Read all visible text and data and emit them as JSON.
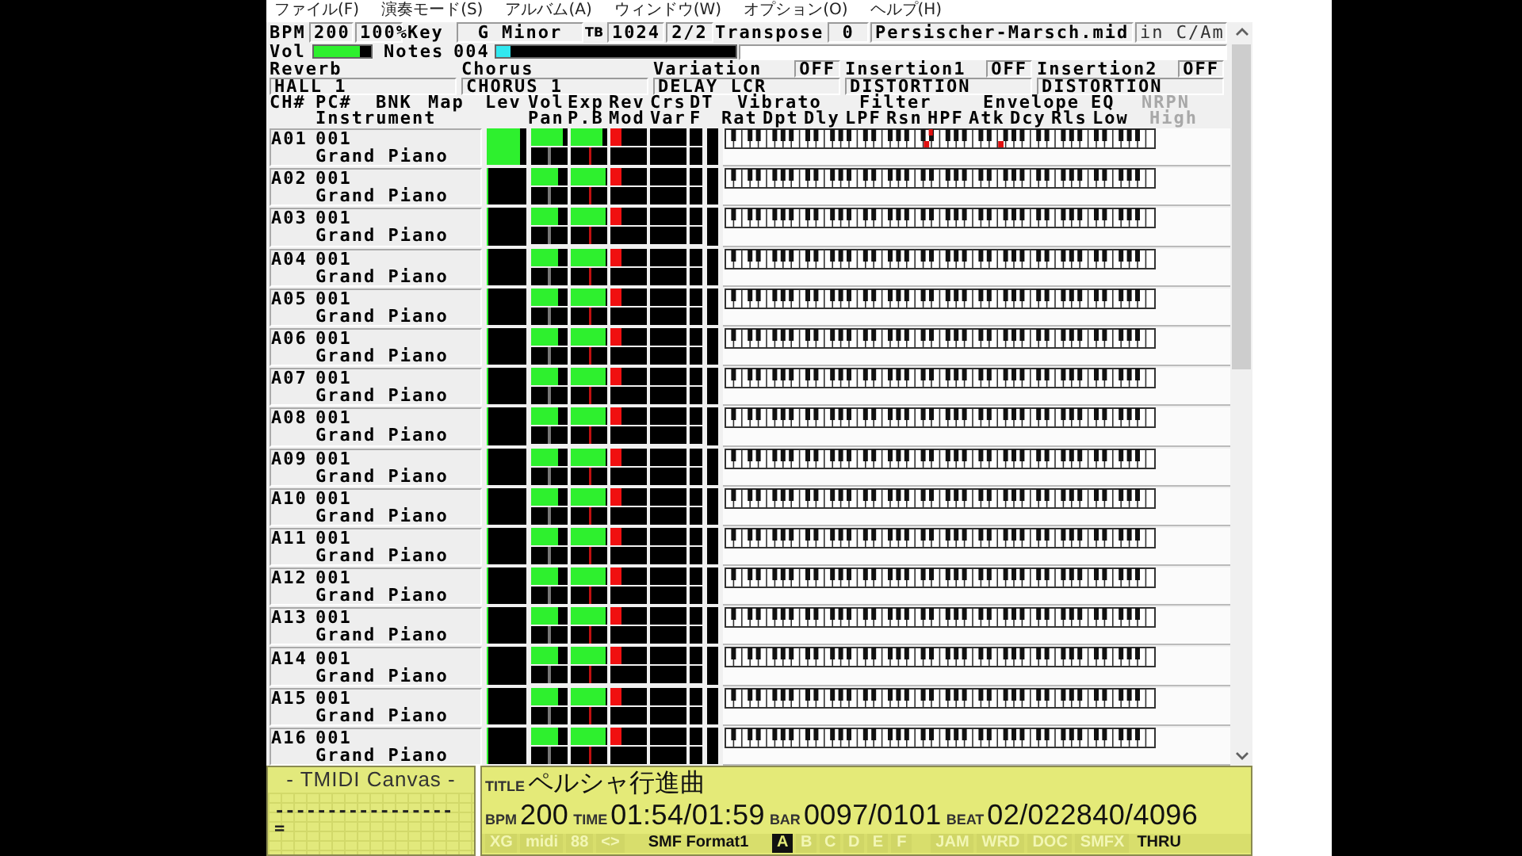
{
  "menu": [
    "ファイル(F)",
    "演奏モード(S)",
    "アルバム(A)",
    "ウィンドウ(W)",
    "オプション(O)",
    "ヘルプ(H)"
  ],
  "transport": {
    "bpm_label": "BPM",
    "bpm": "200",
    "speed": "100%",
    "key_label": "Key",
    "key": "G Minor",
    "tb_label": "TB",
    "tb": "1024",
    "meter": "2/2",
    "transpose_label": "Transpose",
    "transpose": "0",
    "file": "Persischer-Marsch.mid",
    "file_key": "in C/Am"
  },
  "volume": {
    "label": "Vol",
    "level": 0.8
  },
  "notes": {
    "label": "Notes",
    "count": "004",
    "level": 0.06
  },
  "effects": [
    {
      "name": "Reverb",
      "type": "HALL 1"
    },
    {
      "name": "Chorus",
      "type": "CHORUS 1"
    },
    {
      "name": "Variation",
      "state": "OFF",
      "type": "DELAY LCR"
    },
    {
      "name": "Insertion1",
      "state": "OFF",
      "type": "DISTORTION"
    },
    {
      "name": "Insertion2",
      "state": "OFF",
      "type": "DISTORTION"
    }
  ],
  "header": {
    "channel": [
      "CH#",
      "PC#",
      "BNK",
      "Map"
    ],
    "instrument": "Instrument",
    "mixer_top": [
      "Lev",
      "Vol",
      "Exp",
      "Rev",
      "Crs",
      "DT"
    ],
    "mixer_bottom": [
      "Pan",
      "P.B",
      "Mod",
      "Var",
      "F"
    ],
    "groups": [
      {
        "name": "Vibrato",
        "disabled": false,
        "columns": [
          "Rat",
          "Dpt",
          "Dly"
        ]
      },
      {
        "name": "Filter",
        "disabled": false,
        "columns": [
          "LPF",
          "Rsn",
          "HPF"
        ]
      },
      {
        "name": "Envelope",
        "disabled": false,
        "columns": [
          "Atk",
          "Dcy",
          "Rls"
        ]
      },
      {
        "name": "EQ",
        "disabled": false,
        "columns": [
          "Low"
        ]
      },
      {
        "name": "NRPN",
        "disabled": true,
        "columns": [
          "High"
        ]
      }
    ]
  },
  "channels": [
    {
      "id": "A01",
      "program": "001",
      "instrument": "Grand Piano",
      "meters": [
        {
          "kind": "lev",
          "level": 0.85
        },
        {
          "kind": "vol",
          "level": 0.85
        },
        {
          "kind": "exp",
          "level": 0.85
        },
        {
          "kind": "rev",
          "level": 0.3
        }
      ],
      "note_markers": [
        {
          "kind": "white",
          "level": 0.47
        },
        {
          "kind": "black",
          "level": 0.48
        },
        {
          "kind": "white",
          "level": 0.643
        }
      ]
    },
    {
      "id": "A02",
      "program": "001",
      "instrument": "Grand Piano",
      "meters": [
        {
          "kind": "lev",
          "level": 0
        },
        {
          "kind": "vol",
          "level": 0.75
        },
        {
          "kind": "exp",
          "level": 0.95
        },
        {
          "kind": "rev",
          "level": 0.3
        }
      ]
    },
    {
      "id": "A03",
      "program": "001",
      "instrument": "Grand Piano",
      "meters": [
        {
          "kind": "lev",
          "level": 0
        },
        {
          "kind": "vol",
          "level": 0.75
        },
        {
          "kind": "exp",
          "level": 0.95
        },
        {
          "kind": "rev",
          "level": 0.3
        }
      ]
    },
    {
      "id": "A04",
      "program": "001",
      "instrument": "Grand Piano",
      "meters": [
        {
          "kind": "lev",
          "level": 0
        },
        {
          "kind": "vol",
          "level": 0.75
        },
        {
          "kind": "exp",
          "level": 0.95
        },
        {
          "kind": "rev",
          "level": 0.3
        }
      ]
    },
    {
      "id": "A05",
      "program": "001",
      "instrument": "Grand Piano",
      "meters": [
        {
          "kind": "lev",
          "level": 0
        },
        {
          "kind": "vol",
          "level": 0.75
        },
        {
          "kind": "exp",
          "level": 0.95
        },
        {
          "kind": "rev",
          "level": 0.3
        }
      ]
    },
    {
      "id": "A06",
      "program": "001",
      "instrument": "Grand Piano",
      "meters": [
        {
          "kind": "lev",
          "level": 0
        },
        {
          "kind": "vol",
          "level": 0.75
        },
        {
          "kind": "exp",
          "level": 0.95
        },
        {
          "kind": "rev",
          "level": 0.3
        }
      ]
    },
    {
      "id": "A07",
      "program": "001",
      "instrument": "Grand Piano",
      "meters": [
        {
          "kind": "lev",
          "level": 0
        },
        {
          "kind": "vol",
          "level": 0.75
        },
        {
          "kind": "exp",
          "level": 0.95
        },
        {
          "kind": "rev",
          "level": 0.3
        }
      ]
    },
    {
      "id": "A08",
      "program": "001",
      "instrument": "Grand Piano",
      "meters": [
        {
          "kind": "lev",
          "level": 0
        },
        {
          "kind": "vol",
          "level": 0.75
        },
        {
          "kind": "exp",
          "level": 0.95
        },
        {
          "kind": "rev",
          "level": 0.3
        }
      ]
    },
    {
      "id": "A09",
      "program": "001",
      "instrument": "Grand Piano",
      "meters": [
        {
          "kind": "lev",
          "level": 0
        },
        {
          "kind": "vol",
          "level": 0.75
        },
        {
          "kind": "exp",
          "level": 0.95
        },
        {
          "kind": "rev",
          "level": 0.3
        }
      ]
    },
    {
      "id": "A10",
      "program": "001",
      "instrument": "Grand Piano",
      "meters": [
        {
          "kind": "lev",
          "level": 0
        },
        {
          "kind": "vol",
          "level": 0.75
        },
        {
          "kind": "exp",
          "level": 0.95
        },
        {
          "kind": "rev",
          "level": 0.3
        }
      ]
    },
    {
      "id": "A11",
      "program": "001",
      "instrument": "Grand Piano",
      "meters": [
        {
          "kind": "lev",
          "level": 0
        },
        {
          "kind": "vol",
          "level": 0.75
        },
        {
          "kind": "exp",
          "level": 0.95
        },
        {
          "kind": "rev",
          "level": 0.3
        }
      ]
    },
    {
      "id": "A12",
      "program": "001",
      "instrument": "Grand Piano",
      "meters": [
        {
          "kind": "lev",
          "level": 0
        },
        {
          "kind": "vol",
          "level": 0.75
        },
        {
          "kind": "exp",
          "level": 0.95
        },
        {
          "kind": "rev",
          "level": 0.3
        }
      ]
    },
    {
      "id": "A13",
      "program": "001",
      "instrument": "Grand Piano",
      "meters": [
        {
          "kind": "lev",
          "level": 0
        },
        {
          "kind": "vol",
          "level": 0.75
        },
        {
          "kind": "exp",
          "level": 0.95
        },
        {
          "kind": "rev",
          "level": 0.3
        }
      ]
    },
    {
      "id": "A14",
      "program": "001",
      "instrument": "Grand Piano",
      "meters": [
        {
          "kind": "lev",
          "level": 0
        },
        {
          "kind": "vol",
          "level": 0.75
        },
        {
          "kind": "exp",
          "level": 0.95
        },
        {
          "kind": "rev",
          "level": 0.3
        }
      ]
    },
    {
      "id": "A15",
      "program": "001",
      "instrument": "Grand Piano",
      "meters": [
        {
          "kind": "lev",
          "level": 0
        },
        {
          "kind": "vol",
          "level": 0.75
        },
        {
          "kind": "exp",
          "level": 0.95
        },
        {
          "kind": "rev",
          "level": 0.3
        }
      ]
    },
    {
      "id": "A16",
      "program": "001",
      "instrument": "Grand Piano",
      "meters": [
        {
          "kind": "lev",
          "level": 0
        },
        {
          "kind": "vol",
          "level": 0.75
        },
        {
          "kind": "exp",
          "level": 0.95
        },
        {
          "kind": "rev",
          "level": 0.3
        }
      ]
    }
  ],
  "lcd": {
    "title": "- TMIDI Canvas -",
    "line1": "-----------------",
    "line2": "="
  },
  "status": {
    "title_label": "TITLE",
    "title": "ペルシャ行進曲",
    "fields": [
      {
        "label": "BPM",
        "value": "200"
      },
      {
        "label": "TIME",
        "value": "01:54/01:59"
      },
      {
        "label": "BAR",
        "value": "0097/0101"
      },
      {
        "label": "BEAT",
        "value": "02/022840/4096"
      }
    ],
    "indicators": [
      {
        "kind": "tag",
        "label": "XG",
        "on": false
      },
      {
        "kind": "tag",
        "label": "midi",
        "on": false
      },
      {
        "kind": "tag",
        "label": "88",
        "on": false
      },
      {
        "kind": "tag",
        "label": "<>",
        "on": false
      },
      {
        "kind": "tag",
        "label": "SMF Format1",
        "on": true
      },
      {
        "kind": "port",
        "label": "A",
        "on": true
      },
      {
        "kind": "port",
        "label": "B",
        "on": false
      },
      {
        "kind": "port",
        "label": "C",
        "on": false
      },
      {
        "kind": "port",
        "label": "D",
        "on": false
      },
      {
        "kind": "port",
        "label": "E",
        "on": false
      },
      {
        "kind": "port",
        "label": "F",
        "on": false
      },
      {
        "kind": "tag",
        "label": "JAM",
        "on": false
      },
      {
        "kind": "tag",
        "label": "WRD",
        "on": false
      },
      {
        "kind": "tag",
        "label": "DOC",
        "on": false
      },
      {
        "kind": "tag",
        "label": "SMFX",
        "on": false
      },
      {
        "kind": "tag",
        "label": "THRU",
        "on": true
      }
    ]
  }
}
